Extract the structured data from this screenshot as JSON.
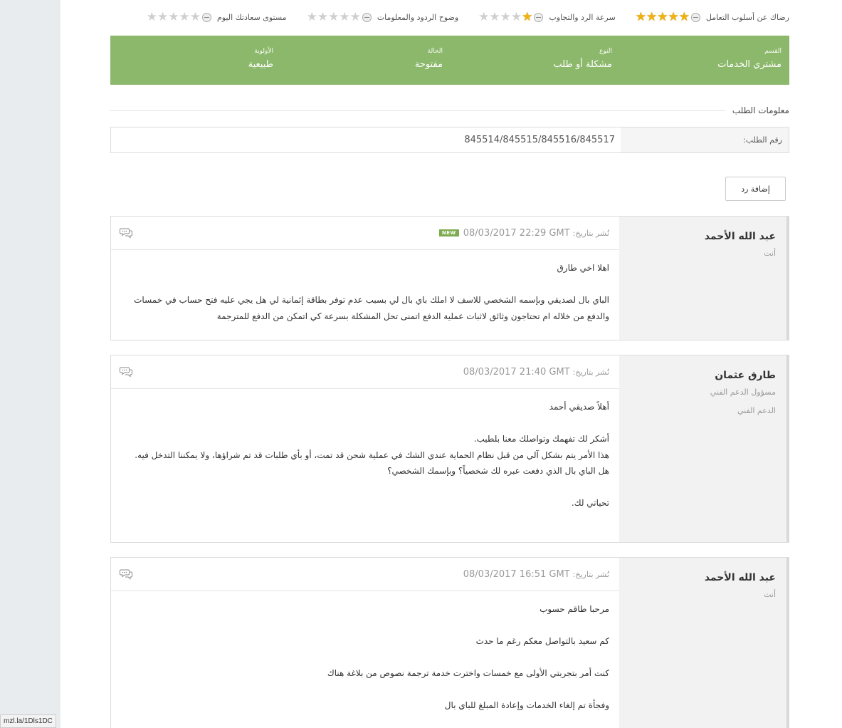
{
  "ratings": [
    {
      "label": "رضاك عن أسلوب التعامل",
      "value": 5,
      "max": 5
    },
    {
      "label": "سرعة الرد والتجاوب",
      "value": 1,
      "max": 5
    },
    {
      "label": "وضوح الردود والمعلومات",
      "value": 0,
      "max": 5
    },
    {
      "label": "مستوى سعادتك اليوم",
      "value": 0,
      "max": 5
    }
  ],
  "details": [
    {
      "label": "القسم",
      "value": "مشتري الخدمات"
    },
    {
      "label": "النوع",
      "value": "مشكلة أو طلب"
    },
    {
      "label": "الحالة",
      "value": "مفتوحة"
    },
    {
      "label": "الأولوية",
      "value": "طبيعية"
    }
  ],
  "section_title": "معلومات الطلب",
  "request": {
    "label": "رقم الطلب:",
    "value": "845514/845515/845516/845517"
  },
  "reply_button": "إضافة رد",
  "posts": [
    {
      "author": "عبد الله الأحمد",
      "role": "أنت",
      "dept": "",
      "date_prefix": "نُشر بتاريخ:",
      "date": "08/03/2017 22:29 GMT",
      "badge": "NEW",
      "paragraphs": [
        "اهلا اخي طارق",
        "",
        "الباي بال لصديقي وبإسمه الشخصي للاسف لا املك باي بال لي بسبب عدم توفر بطاقة إئمانية لي هل يجي عليه فتح حساب في خمسات والدفع من خلاله ام تحتاجون وثائق لاثبات عملية الدفع اتمنى تحل المشكلة بسرعة كي اتمكن من الدفع للمترجمة"
      ]
    },
    {
      "author": "طارق عثمان",
      "role": "مسؤول الدعم الفني",
      "dept": "الدعم الفني",
      "date_prefix": "نُشر بتاريخ:",
      "date": "08/03/2017 21:40 GMT",
      "badge": "",
      "paragraphs": [
        "أهلاً صديقي أحمد",
        "",
        "أشكر لك تفهمك وتواصلك معنا بلطيب.",
        "هذا الأمر يتم بشكل آلي من قبل نظام الحماية عندي الشك في عملية شحن قد تمت، أو بأي طلبات قد تم شراؤها، ولا يمكننا التدخل فيه.",
        "هل الباي بال الذي دفعت عبره لك شخصياً؟ وبإسمك الشخصي؟",
        "",
        "تحياتي لك."
      ]
    },
    {
      "author": "عبد الله الأحمد",
      "role": "أنت",
      "dept": "",
      "date_prefix": "نُشر بتاريخ:",
      "date": "08/03/2017 16:51 GMT",
      "badge": "",
      "paragraphs": [
        "مرحبا طاقم حسوب",
        "",
        "كم سعيد بالتواصل معكم رغم ما حدث",
        "",
        "كنت أمر بتجربتي الأولى مع خمسات واخترت خدمة ترجمة نصوص من بلاغة هناك",
        "",
        "وفجأة تم إلغاء الخدمات وإعادة المبلغ للباي بال"
      ]
    }
  ],
  "status_url": "mzl.la/1Dls1DC"
}
